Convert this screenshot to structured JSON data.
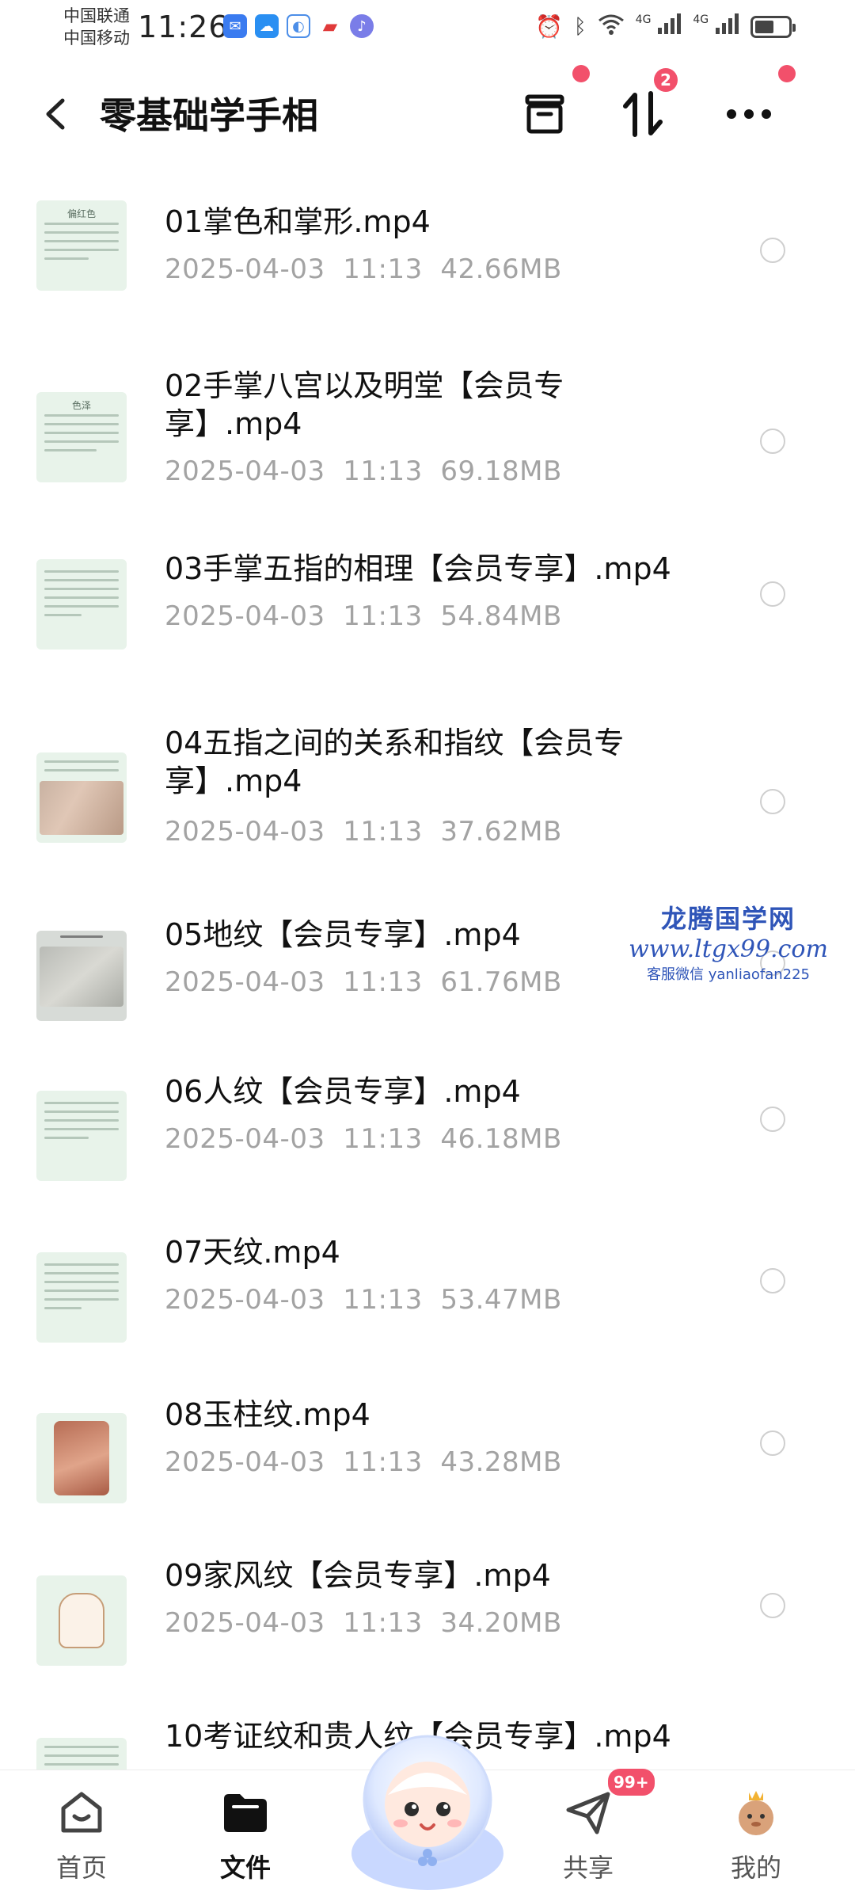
{
  "status_bar": {
    "carrier_1": "中国联通",
    "carrier_2": "中国移动",
    "time": "11:26",
    "network_1": "4G",
    "network_2": "4G"
  },
  "header": {
    "title": "零基础学手相",
    "transfer_badge": "2"
  },
  "files": [
    {
      "name": "01掌色和掌形.mp4",
      "date": "2025-04-03",
      "time": "11:13",
      "size": "42.66MB",
      "thumb_caption": "偏红色"
    },
    {
      "name": "02手掌八宫以及明堂【会员专享】.mp4",
      "date": "2025-04-03",
      "time": "11:13",
      "size": "69.18MB",
      "thumb_caption": "色泽"
    },
    {
      "name": "03手掌五指的相理【会员专享】.mp4",
      "date": "2025-04-03",
      "time": "11:13",
      "size": "54.84MB",
      "thumb_caption": ""
    },
    {
      "name": "04五指之间的关系和指纹【会员专享】.mp4",
      "date": "2025-04-03",
      "time": "11:13",
      "size": "37.62MB",
      "thumb_caption": ""
    },
    {
      "name": "05地纹【会员专享】.mp4",
      "date": "2025-04-03",
      "time": "11:13",
      "size": "61.76MB",
      "thumb_caption": ""
    },
    {
      "name": "06人纹【会员专享】.mp4",
      "date": "2025-04-03",
      "time": "11:13",
      "size": "46.18MB",
      "thumb_caption": ""
    },
    {
      "name": "07天纹.mp4",
      "date": "2025-04-03",
      "time": "11:13",
      "size": "53.47MB",
      "thumb_caption": ""
    },
    {
      "name": "08玉柱纹.mp4",
      "date": "2025-04-03",
      "time": "11:13",
      "size": "43.28MB",
      "thumb_caption": ""
    },
    {
      "name": "09家风纹【会员专享】.mp4",
      "date": "2025-04-03",
      "time": "11:13",
      "size": "34.20MB",
      "thumb_caption": ""
    },
    {
      "name": "10考证纹和贵人纹【会员专享】.mp4",
      "date": "",
      "time": "",
      "size": "",
      "thumb_caption": ""
    }
  ],
  "watermark": {
    "title": "龙腾国学网",
    "url": "www.ltgx99.com",
    "wechat": "客服微信 yanliaofan225"
  },
  "bottom_nav": {
    "items": [
      {
        "label": "首页",
        "icon": "home-icon"
      },
      {
        "label": "文件",
        "icon": "folder-icon"
      },
      {
        "label": "共享",
        "icon": "paper-plane-icon",
        "badge": "99+"
      },
      {
        "label": "我的",
        "icon": "avatar-icon"
      }
    ]
  },
  "colors": {
    "accent_red": "#f2506b",
    "meta_gray": "#a3a3a3",
    "watermark_blue": "#2f55b8"
  }
}
